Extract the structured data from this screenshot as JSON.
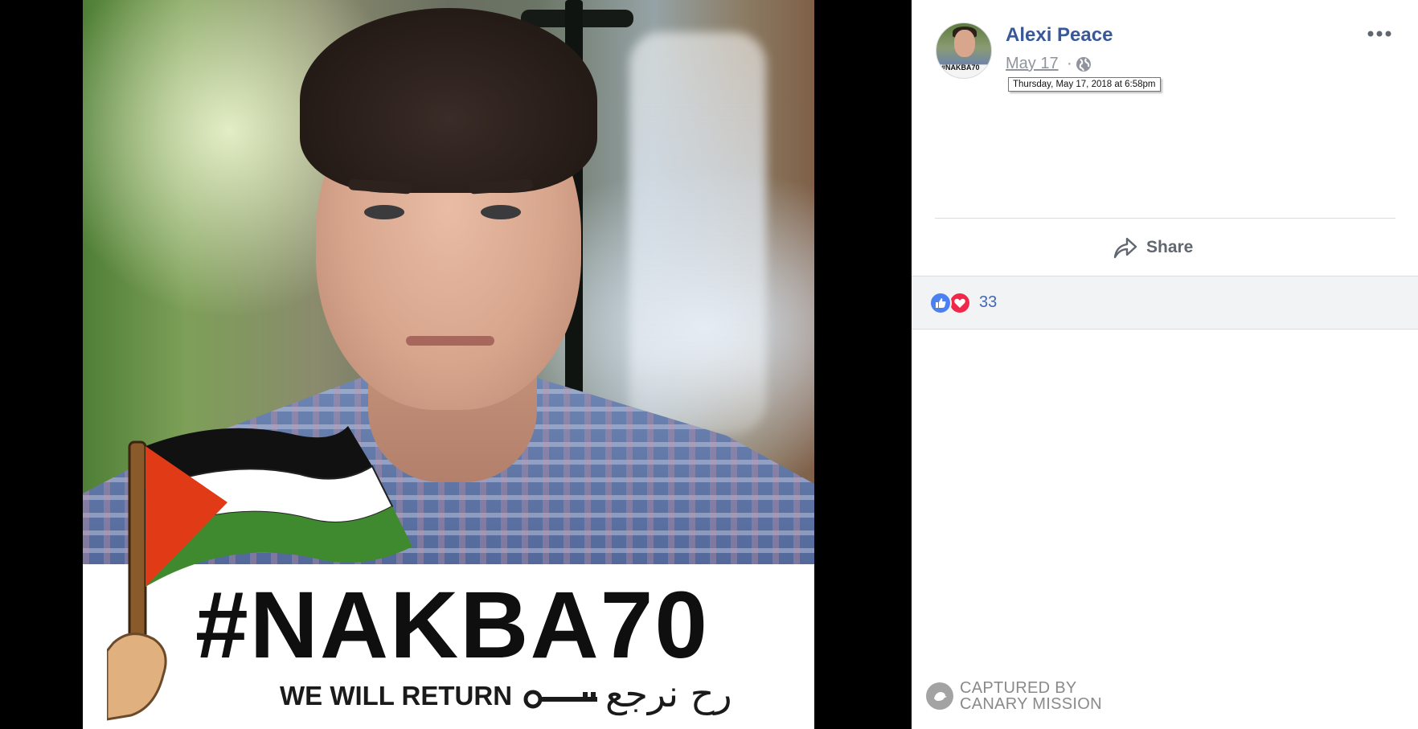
{
  "post": {
    "author_name": "Alexi Peace",
    "date": "May 17",
    "separator": "·",
    "date_tooltip": "Thursday, May 17, 2018 at 6:58pm",
    "privacy_icon": "globe-icon",
    "more_icon": "more-horizontal-icon",
    "avatar_tag": "#NAKBA70"
  },
  "actions": {
    "share_label": "Share",
    "share_icon": "share-arrow-icon"
  },
  "reactions": {
    "count": "33",
    "types": [
      "like",
      "love"
    ]
  },
  "photo": {
    "banner_title": "#NAKBA70",
    "banner_subtitle": "WE WILL RETURN",
    "banner_arabic": "رح نرجع"
  },
  "watermark": {
    "line1": "CAPTURED BY",
    "line2": "CANARY MISSION"
  },
  "colors": {
    "link_blue": "#385898",
    "meta_gray": "#90949c",
    "reaction_bar_bg": "#f2f3f5",
    "like_blue": "#4b80f0",
    "love_red": "#f0284a",
    "flag_red": "#e03a17",
    "flag_green": "#3f8a2f",
    "flag_black": "#111111"
  }
}
